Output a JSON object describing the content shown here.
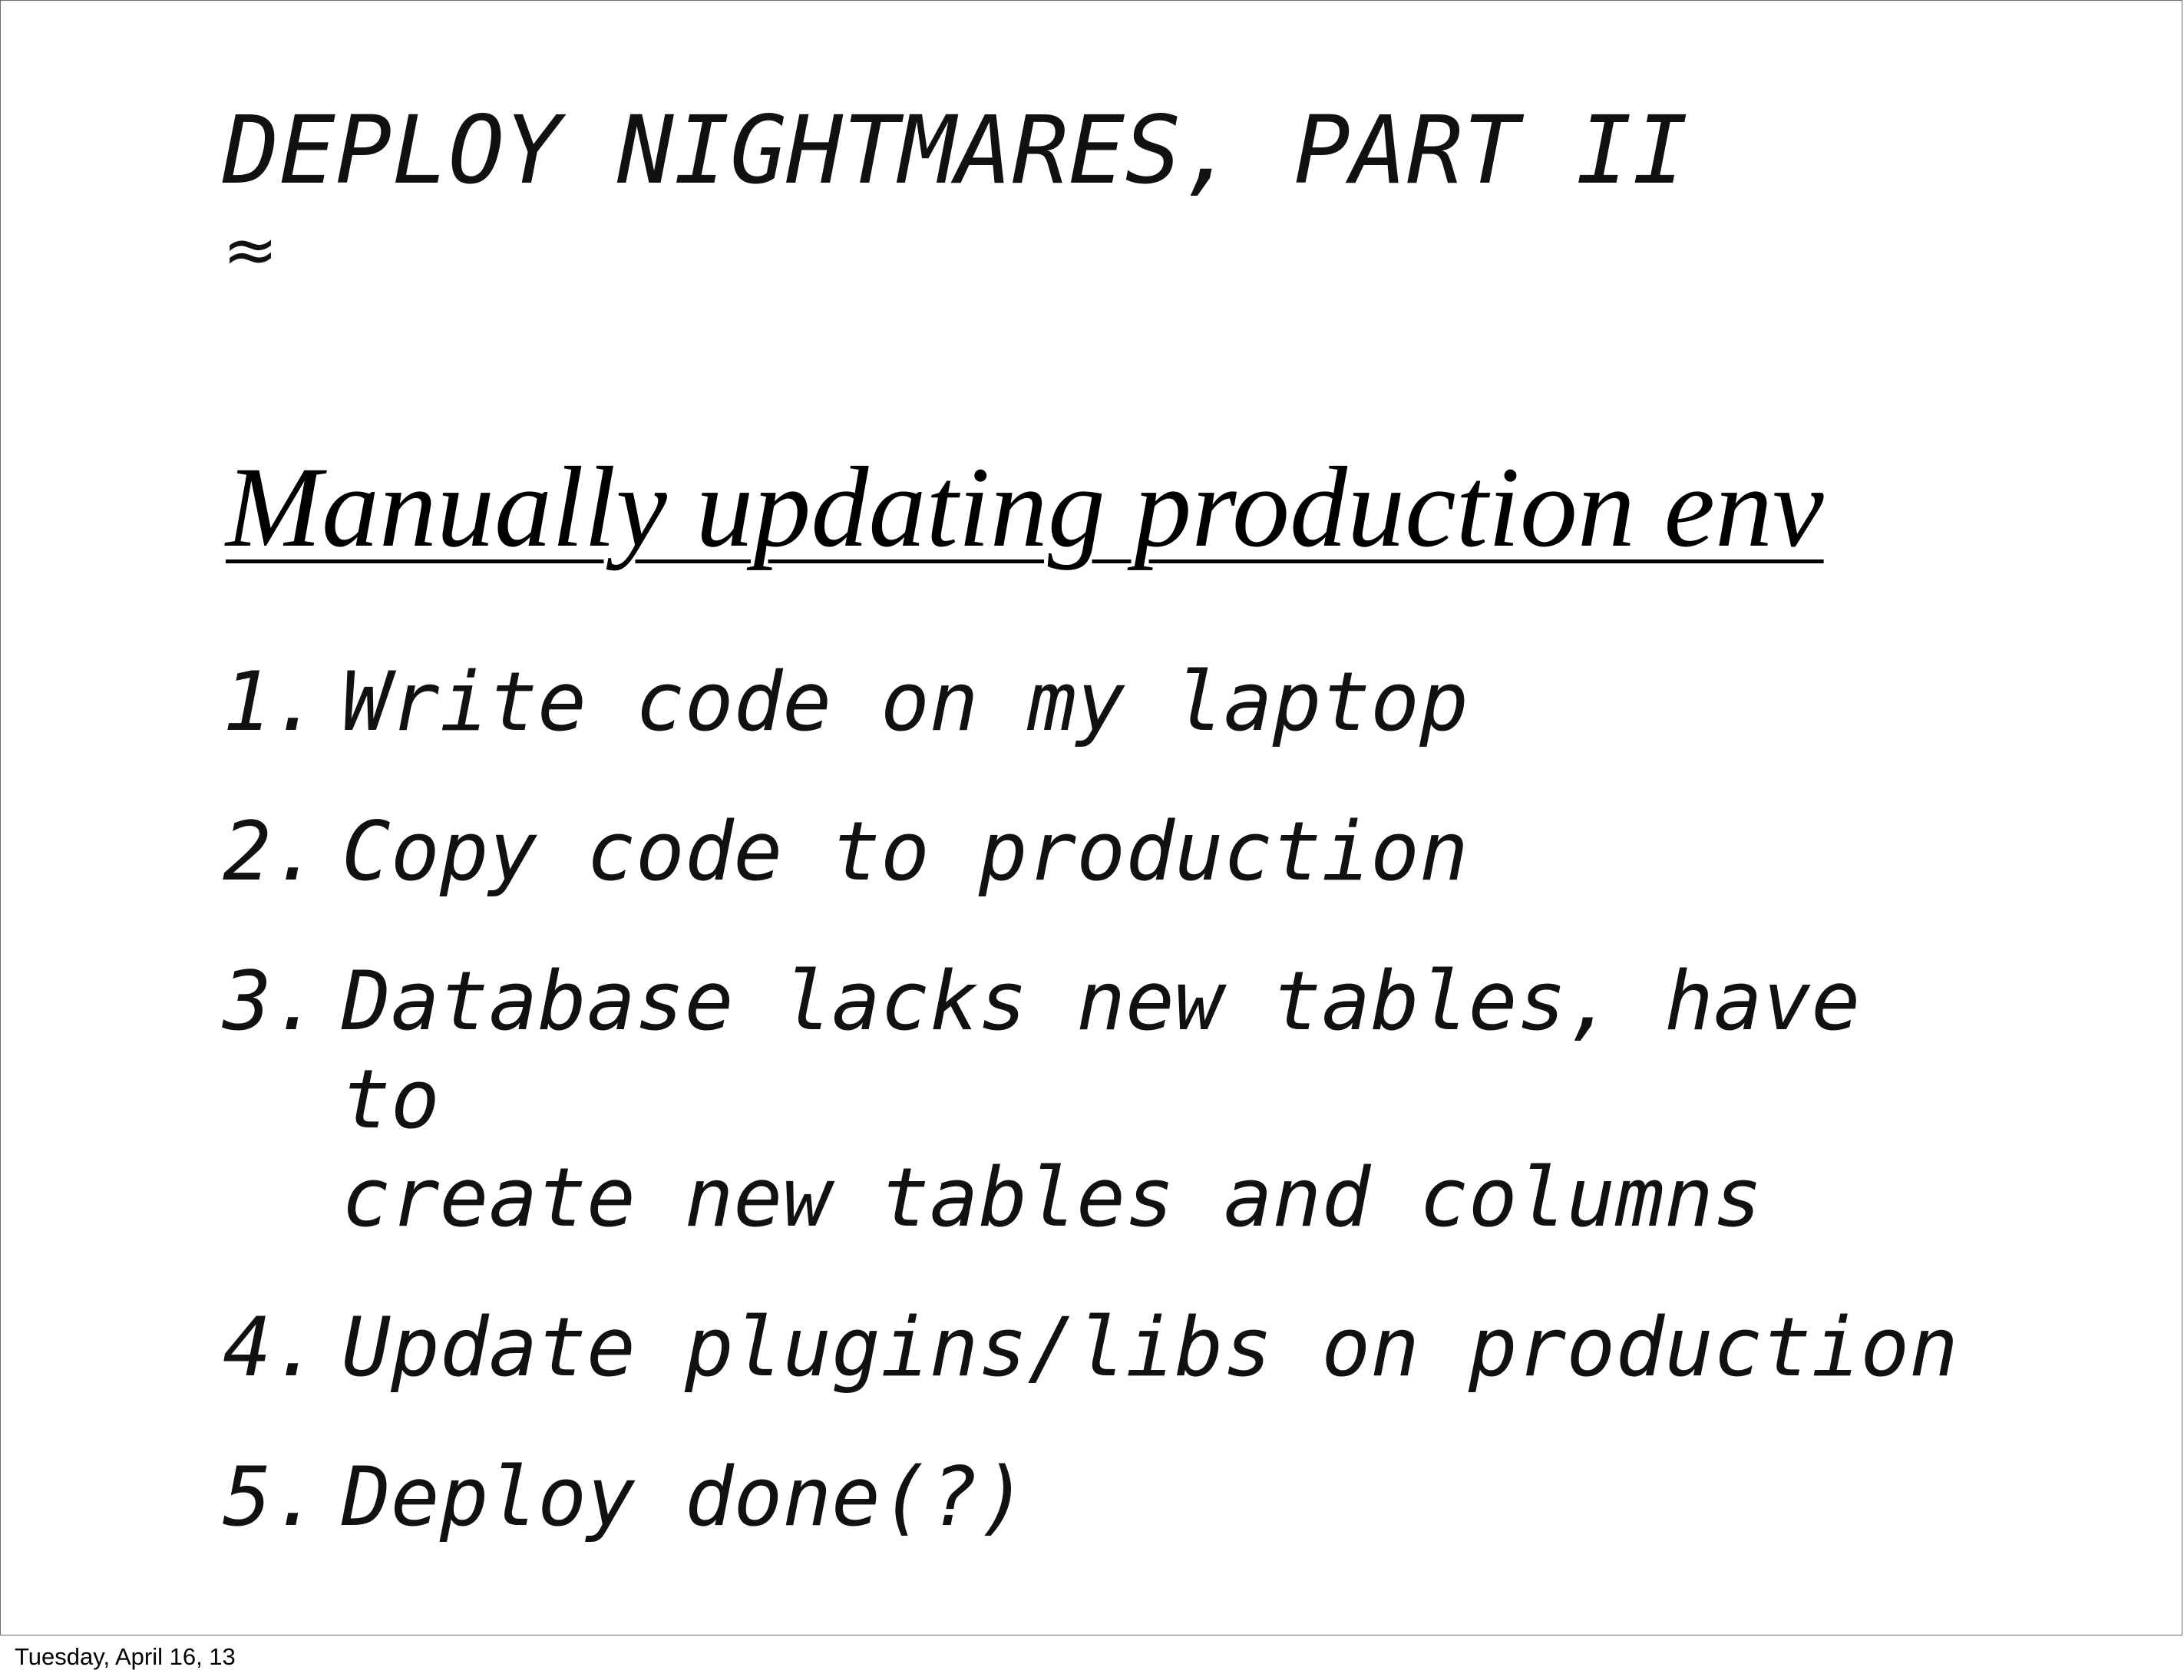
{
  "slide": {
    "title": "DEPLOY NIGHTMARES, PART II",
    "symbol": "≈",
    "subtitle": "Manually updating production env",
    "steps": [
      {
        "number": "1.",
        "text": "Write code on my laptop"
      },
      {
        "number": "2.",
        "text": "Copy code to production"
      },
      {
        "number": "3.",
        "text": "Database lacks new tables, have to\ncreate new tables and columns"
      },
      {
        "number": "4.",
        "text": "Update plugins/libs on production"
      },
      {
        "number": "5.",
        "text": "Deploy done(?)"
      }
    ]
  },
  "footer": {
    "date": "Tuesday, April 16, 13"
  }
}
